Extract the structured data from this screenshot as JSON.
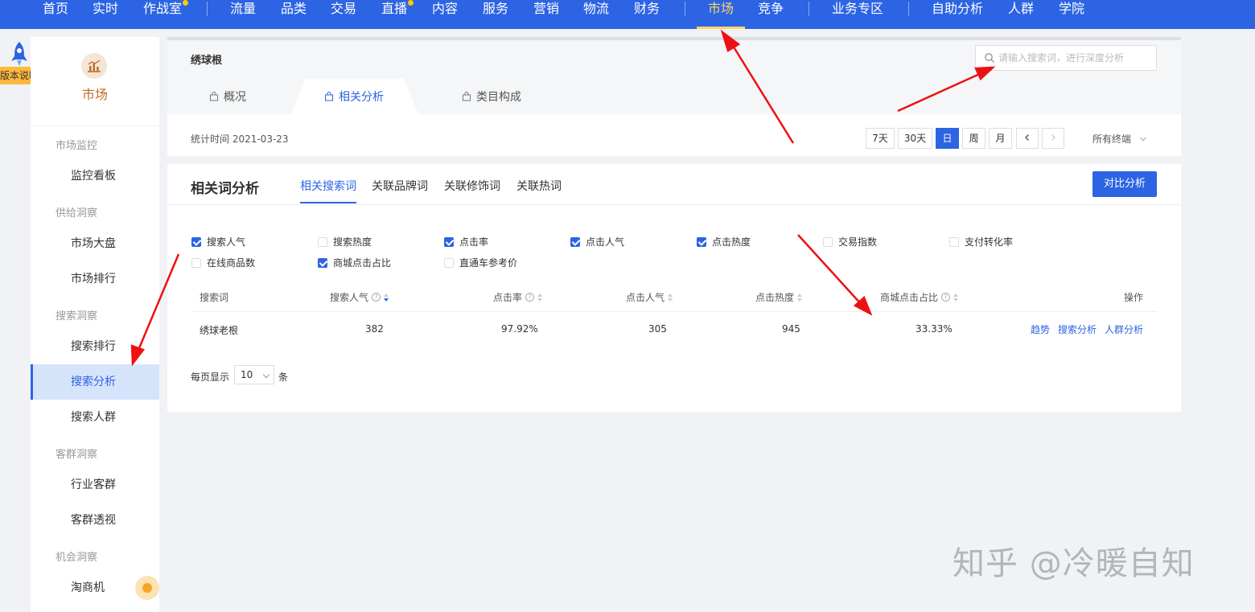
{
  "topnav": {
    "items": [
      "首页",
      "实时",
      "作战室",
      "流量",
      "品类",
      "交易",
      "直播",
      "内容",
      "服务",
      "营销",
      "物流",
      "财务",
      "市场",
      "竞争",
      "业务专区",
      "自助分析",
      "人群",
      "学院"
    ],
    "active": "市场",
    "accent": "#2c64e3",
    "active_color": "#ffd666"
  },
  "version_badge": "版本说明",
  "sidebar": {
    "title": "市场",
    "groups": [
      {
        "label": "市场监控",
        "items": [
          "监控看板"
        ]
      },
      {
        "label": "供给洞察",
        "items": [
          "市场大盘",
          "市场排行"
        ]
      },
      {
        "label": "搜索洞察",
        "items": [
          "搜索排行",
          "搜索分析",
          "搜索人群"
        ]
      },
      {
        "label": "客群洞察",
        "items": [
          "行业客群",
          "客群透视"
        ]
      },
      {
        "label": "机会洞察",
        "items": [
          "淘商机"
        ]
      }
    ],
    "active_item": "搜索分析"
  },
  "header": {
    "keyword": "绣球根",
    "search_placeholder": "请输入搜索词，进行深度分析",
    "tabs": [
      "概况",
      "相关分析",
      "类目构成"
    ],
    "active_tab": "相关分析",
    "stat_time": "统计时间 2021-03-23",
    "periods": [
      "7天",
      "30天",
      "日",
      "周",
      "月"
    ],
    "active_period": "日",
    "terminal": "所有终端"
  },
  "analysis": {
    "title": "相关词分析",
    "tabs": [
      "相关搜索词",
      "关联品牌词",
      "关联修饰词",
      "关联热词"
    ],
    "active_tab": "相关搜索词",
    "compare_button": "对比分析",
    "metrics": [
      {
        "label": "搜索人气",
        "checked": true
      },
      {
        "label": "搜索热度",
        "checked": false
      },
      {
        "label": "点击率",
        "checked": true
      },
      {
        "label": "点击人气",
        "checked": true
      },
      {
        "label": "点击热度",
        "checked": true
      },
      {
        "label": "交易指数",
        "checked": false
      },
      {
        "label": "支付转化率",
        "checked": false
      },
      {
        "label": "在线商品数",
        "checked": false
      },
      {
        "label": "商城点击占比",
        "checked": true
      },
      {
        "label": "直通车参考价",
        "checked": false
      }
    ],
    "columns": [
      "搜索词",
      "搜索人气",
      "点击率",
      "点击人气",
      "点击热度",
      "商城点击占比",
      "操作"
    ],
    "rows": [
      {
        "keyword": "绣球老根",
        "search_popularity": "382",
        "ctr": "97.92%",
        "click_popularity": "305",
        "click_heat": "945",
        "mall_click_ratio": "33.33%"
      }
    ],
    "row_actions": [
      "趋势",
      "搜索分析",
      "人群分析"
    ],
    "per_page_label": "每页显示",
    "per_page_value": "10",
    "per_page_unit": "条"
  },
  "watermark": "知乎 @冷暖自知"
}
